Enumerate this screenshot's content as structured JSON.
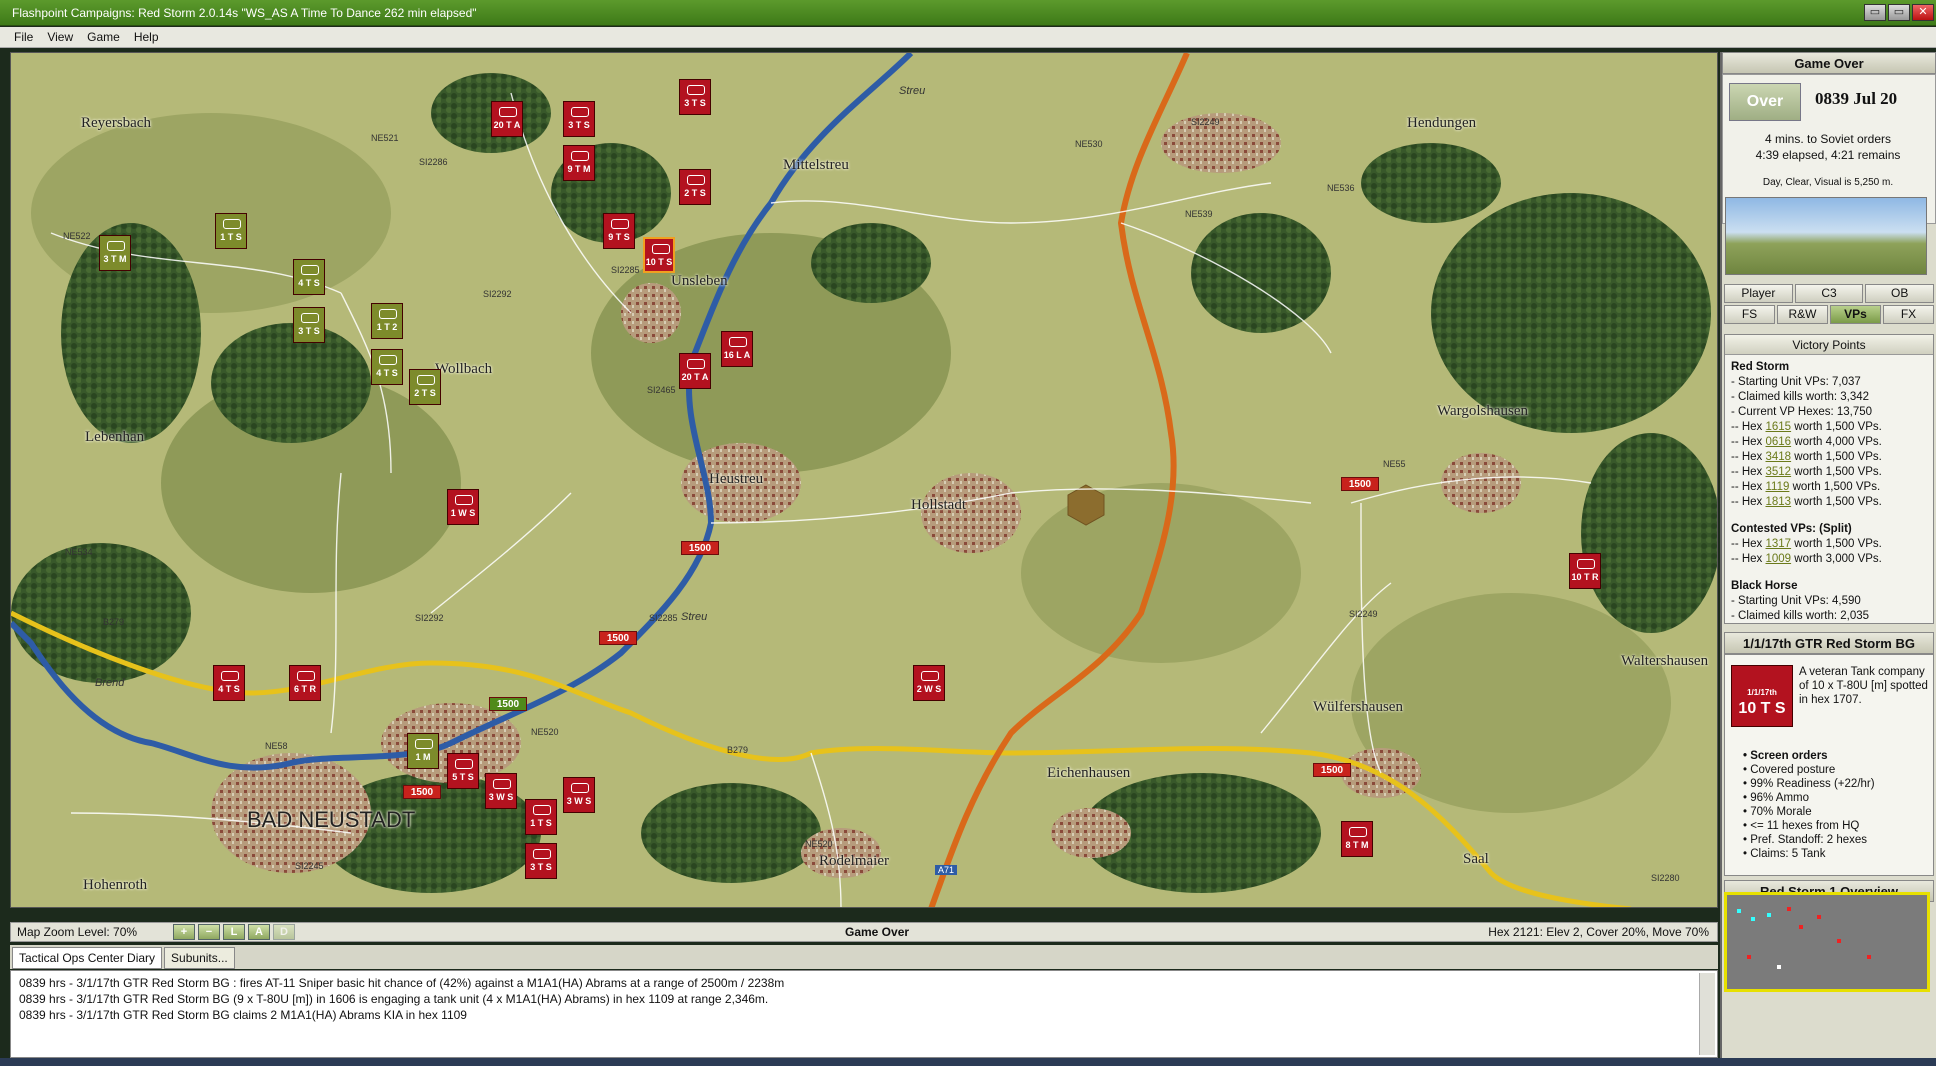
{
  "window": {
    "title": "Flashpoint Campaigns: Red Storm  2.0.14s  \"WS_AS A Time To Dance 262 min elapsed\"",
    "buttons": [
      "▭",
      "▭",
      "✕"
    ]
  },
  "menu": [
    "File",
    "View",
    "Game",
    "Help"
  ],
  "map": {
    "towns": [
      "Reyersbach",
      "Mittelstreu",
      "Hendungen",
      "Unsleben",
      "Wollbach",
      "Lebenhan",
      "Heustreu",
      "Hollstadt",
      "Wargolshausen",
      "Waltershausen",
      "Wülfershausen",
      "Eichenhausen",
      "Rodelmaier",
      "Saal",
      "Hohenroth",
      "BAD NEUSTADT"
    ],
    "road_labels": [
      "NE522",
      "NE521",
      "SI2286",
      "NE530",
      "SI2249",
      "NE539",
      "NE536",
      "SI2292",
      "SI2285",
      "SI2465",
      "NE534",
      "B279",
      "SI2292",
      "SI2285",
      "NE58",
      "NE520",
      "B279",
      "SI2245",
      "NE520",
      "A71",
      "SI2249",
      "NE55",
      "SI2280",
      "Streu",
      "Streu",
      "Brend"
    ],
    "vp_markers": [
      "1500",
      "1500",
      "1500",
      "1500",
      "1500",
      "1500"
    ],
    "units": [
      {
        "t": "20 T A",
        "c": "red"
      },
      {
        "t": "3 T S",
        "c": "red"
      },
      {
        "t": "3 T S",
        "c": "red"
      },
      {
        "t": "9 T M",
        "c": "red"
      },
      {
        "t": "2 T S",
        "c": "red"
      },
      {
        "t": "9 T S",
        "c": "red"
      },
      {
        "t": "10 T S",
        "c": "red"
      },
      {
        "t": "3 T M",
        "c": "grn"
      },
      {
        "t": "1 T S",
        "c": "grn"
      },
      {
        "t": "4 T S",
        "c": "grn"
      },
      {
        "t": "3 T S",
        "c": "grn"
      },
      {
        "t": "1 T 2",
        "c": "grn"
      },
      {
        "t": "4 T S",
        "c": "grn"
      },
      {
        "t": "2 T S",
        "c": "grn"
      },
      {
        "t": "16 L A",
        "c": "red"
      },
      {
        "t": "20 T A",
        "c": "red"
      },
      {
        "t": "1 W S",
        "c": "red"
      },
      {
        "t": "4 T S",
        "c": "red"
      },
      {
        "t": "6 T R",
        "c": "red"
      },
      {
        "t": "1 M",
        "c": "grn"
      },
      {
        "t": "5 T S",
        "c": "red"
      },
      {
        "t": "3 W S",
        "c": "red"
      },
      {
        "t": "1 T S",
        "c": "red"
      },
      {
        "t": "3 W S",
        "c": "red"
      },
      {
        "t": "3 T S",
        "c": "red"
      },
      {
        "t": "2 W S",
        "c": "red"
      },
      {
        "t": "10 T R",
        "c": "red"
      },
      {
        "t": "8 T M",
        "c": "red"
      }
    ]
  },
  "status": {
    "zoom": "Map Zoom Level: 70%",
    "zoom_buttons": [
      "+",
      "−",
      "L",
      "A",
      "D"
    ],
    "center": "Game Over",
    "hex": "Hex 2121: Elev 2, Cover 20%, Move 70%"
  },
  "log": {
    "tabs": [
      "Tactical Ops Center Diary",
      "Subunits..."
    ],
    "lines": [
      "0839 hrs - 3/1/17th GTR Red Storm BG : fires AT-11 Sniper basic hit chance of (42%) against a M1A1(HA) Abrams at a range of 2500m / 2238m",
      "0839 hrs - 3/1/17th GTR Red Storm BG (9 x T-80U [m]) in 1606 is engaging a tank unit (4 x M1A1(HA) Abrams) in hex 1109 at range 2,346m.",
      "0839 hrs - 3/1/17th GTR Red Storm BG claims 2 M1A1(HA) Abrams KIA in hex 1109"
    ]
  },
  "right": {
    "header": "Game Over",
    "over_btn": "Over",
    "date": "0839 Jul 20",
    "mins": "4 mins. to Soviet orders",
    "elapsed": "4:39 elapsed, 4:21 remains",
    "weather": "Day, Clear, Visual is 5,250 m.",
    "tabs_row1": [
      "Player",
      "C3",
      "OB"
    ],
    "tabs_row2": [
      "FS",
      "R&W",
      "VPs",
      "FX"
    ],
    "vp_title": "Victory Points",
    "vp": {
      "red_head": "Red Storm",
      "red_lines": [
        "- Starting Unit VPs: 7,037",
        "- Claimed kills worth: 3,342",
        "- Current VP Hexes: 13,750"
      ],
      "hexes": [
        {
          "h": "1615",
          "w": "worth 1,500 VPs."
        },
        {
          "h": "0616",
          "w": "worth 4,000 VPs."
        },
        {
          "h": "3418",
          "w": "worth 1,500 VPs."
        },
        {
          "h": "3512",
          "w": "worth 1,500 VPs."
        },
        {
          "h": "1119",
          "w": "worth 1,500 VPs."
        },
        {
          "h": "1813",
          "w": "worth 1,500 VPs."
        }
      ],
      "contested_head": "Contested VPs: (Split)",
      "contested": [
        {
          "h": "1317",
          "w": "worth 1,500 VPs."
        },
        {
          "h": "1009",
          "w": "worth 3,000 VPs."
        }
      ],
      "bh_head": "Black Horse",
      "bh_lines": [
        "- Starting Unit VPs: 4,590",
        "- Claimed kills worth: 2,035"
      ]
    },
    "unit_head": "1/1/17th GTR Red Storm BG",
    "unit_counter": {
      "top": "1/1/17th",
      "main": "10 T S"
    },
    "unit_desc": "A veteran Tank company of 10 x T-80U [m] spotted in hex 1707.",
    "unit_list": [
      "Screen orders",
      "Covered posture",
      "99% Readiness (+22/hr)",
      "96% Ammo",
      "70% Morale",
      "<= 11 hexes from HQ",
      "Pref. Standoff: 2 hexes",
      "Claims: 5 Tank"
    ],
    "overview_head": "Red Storm 1 Overview"
  }
}
